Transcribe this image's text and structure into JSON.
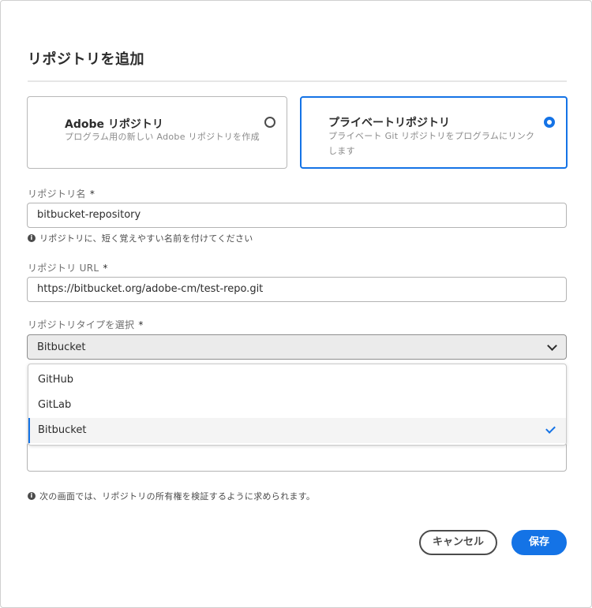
{
  "dialog": {
    "title": "リポジトリを追加"
  },
  "repo_types": [
    {
      "title": "Adobe リポジトリ",
      "description": "プログラム用の新しい Adobe リポジトリを作成",
      "selected": false
    },
    {
      "title": "プライベートリポジトリ",
      "description": "プライベート Git リポジトリをプログラムにリンクします",
      "selected": true
    }
  ],
  "fields": {
    "name": {
      "label": "リポジトリ名",
      "required_mark": "*",
      "value": "bitbucket-repository",
      "help": "リポジトリに、短く覚えやすい名前を付けてください"
    },
    "url": {
      "label": "リポジトリ URL",
      "required_mark": "*",
      "value": "https://bitbucket.org/adobe-cm/test-repo.git"
    },
    "type": {
      "label": "リポジトリタイプを選択",
      "required_mark": "*",
      "selected": "Bitbucket",
      "options": [
        "GitHub",
        "GitLab",
        "Bitbucket"
      ]
    }
  },
  "notice": "次の画面では、リポジトリの所有権を検証するように求められます。",
  "buttons": {
    "cancel": "キャンセル",
    "save": "保存"
  },
  "colors": {
    "accent": "#1473e6"
  },
  "icons": {
    "info": "info-icon",
    "chevron": "chevron-down-icon",
    "check": "checkmark-icon"
  }
}
